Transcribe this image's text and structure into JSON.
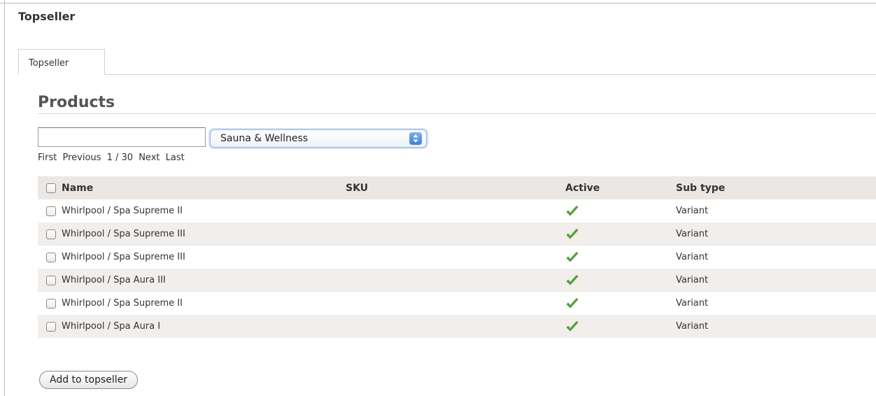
{
  "page": {
    "title": "Topseller"
  },
  "tabs": [
    {
      "label": "Topseller"
    }
  ],
  "products": {
    "heading": "Products",
    "search": {
      "value": "",
      "placeholder": ""
    },
    "category_select": {
      "selected": "Sauna & Wellness"
    },
    "pager": {
      "first": "First",
      "previous": "Previous",
      "page_info": "1 / 30",
      "next": "Next",
      "last": "Last"
    },
    "table": {
      "columns": [
        "Name",
        "SKU",
        "Active",
        "Sub type"
      ],
      "rows": [
        {
          "name": "Whirlpool / Spa Supreme II",
          "sku": "",
          "active": true,
          "sub_type": "Variant"
        },
        {
          "name": "Whirlpool / Spa Supreme III",
          "sku": "",
          "active": true,
          "sub_type": "Variant"
        },
        {
          "name": "Whirlpool / Spa Supreme III",
          "sku": "",
          "active": true,
          "sub_type": "Variant"
        },
        {
          "name": "Whirlpool / Spa Aura III",
          "sku": "",
          "active": true,
          "sub_type": "Variant"
        },
        {
          "name": "Whirlpool / Spa Supreme II",
          "sku": "",
          "active": true,
          "sub_type": "Variant"
        },
        {
          "name": "Whirlpool / Spa Aura I",
          "sku": "",
          "active": true,
          "sub_type": "Variant"
        }
      ]
    },
    "add_button": {
      "label": "Add to topseller"
    }
  },
  "icons": {
    "active": "checkmark-icon",
    "select_arrow": "updown-arrows-icon"
  },
  "colors": {
    "check_green": "#5aa83a",
    "header_bg": "#ebe7e5",
    "row_alt_bg": "#f1eeec",
    "select_focus": "#cfe0f7"
  }
}
